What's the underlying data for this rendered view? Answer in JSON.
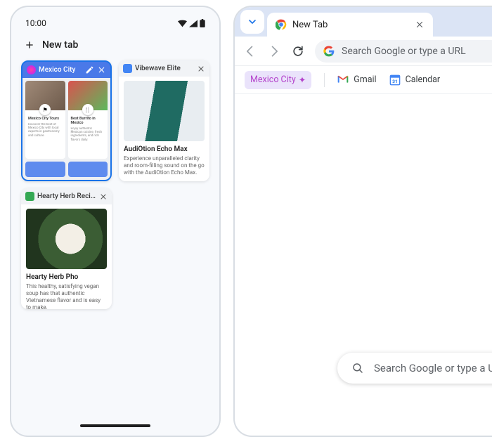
{
  "phone": {
    "status": {
      "time": "10:00"
    },
    "newTabLabel": "New tab",
    "tabs": [
      {
        "title": "Mexico City",
        "selected": true,
        "tiles": [
          {
            "title": "Mexico City Tours",
            "desc": "Discover the best of Mexico City with local experts in gastronomy and culture."
          },
          {
            "title": "Best Burrito in Mexico",
            "desc": "Enjoy authentic Mexican cuisine, fresh ingredients, and rich flavors daily."
          }
        ]
      },
      {
        "title": "Vibewave Elite",
        "selected": false,
        "cardTitle": "AudiOtion Echo Max",
        "cardDesc": "Experience unparalleled clarity and room-filling sound on the go with the AudiOtion Echo Max."
      },
      {
        "title": "Hearty Herb Recipe",
        "selected": false,
        "cardTitle": "Hearty Herb Pho",
        "cardDesc": "This healthy, satisfying vegan soup has that authentic Vietnamese flavor and is easy to make."
      }
    ]
  },
  "tablet": {
    "tabLabel": "New Tab",
    "omniboxPlaceholder": "Search Google or type a URL",
    "bookmarks": {
      "chip": "Mexico City",
      "items": [
        {
          "label": "Gmail",
          "color1": "#ea4335",
          "color2": "#4285f4"
        },
        {
          "label": "Calendar",
          "color": "#1a73e8",
          "day": "31"
        }
      ]
    },
    "ntpSearchPlaceholder": "Search Google or type a URL"
  },
  "colors": {
    "accent": "#1a73e8",
    "googleBlue": "#4285f4",
    "googleRed": "#ea4335",
    "googleYellow": "#fbbc04",
    "googleGreen": "#34a853",
    "chipBg": "#eae3fb",
    "chipText": "#b443cc"
  }
}
